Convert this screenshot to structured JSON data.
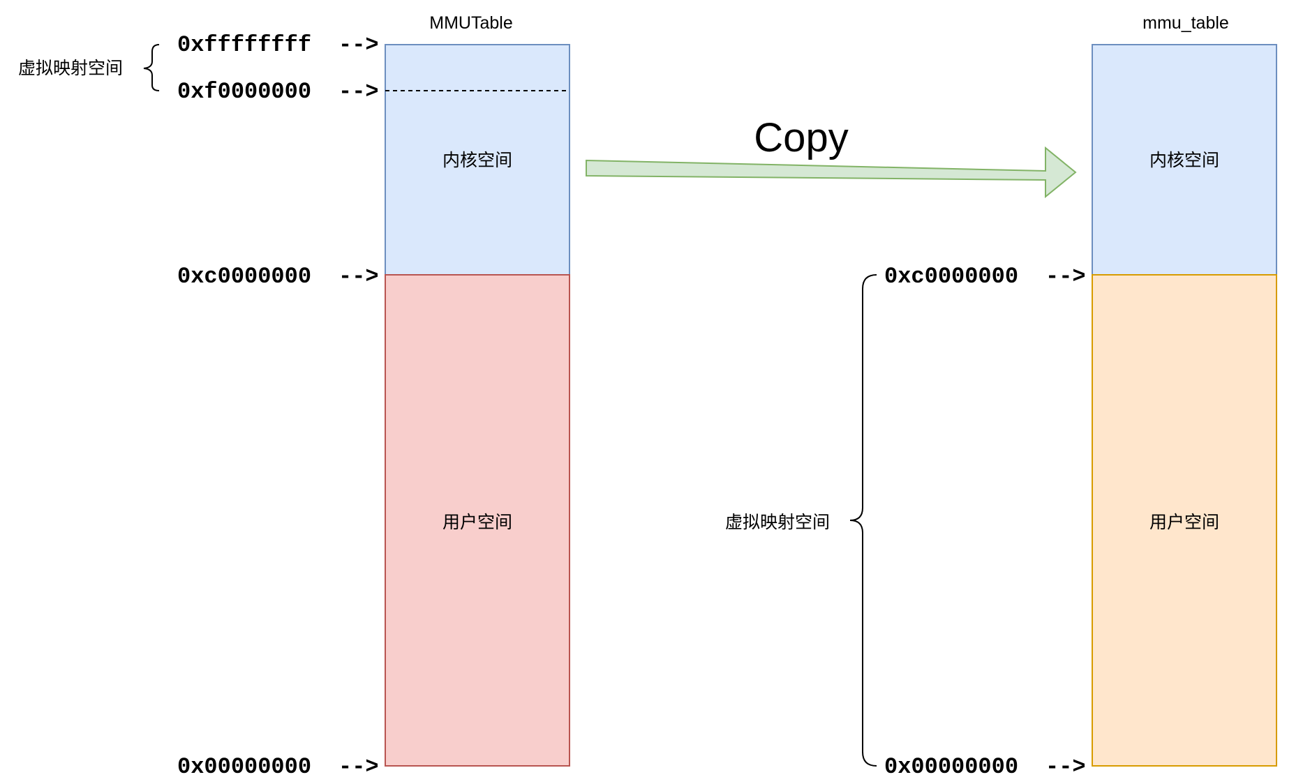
{
  "left_table": {
    "title": "MMUTable",
    "kernel_label": "内核空间",
    "user_label": "用户空间",
    "bracket_label": "虚拟映射空间",
    "addresses": {
      "top": "0xffffffff",
      "mapped_start": "0xf0000000",
      "kernel_start": "0xc0000000",
      "bottom": "0x00000000"
    },
    "colors": {
      "kernel_fill": "#dae8fc",
      "kernel_stroke": "#6c8ebf",
      "user_fill": "#f8cecc",
      "user_stroke": "#b85450"
    }
  },
  "right_table": {
    "title": "mmu_table",
    "kernel_label": "内核空间",
    "user_label": "用户空间",
    "bracket_label": "虚拟映射空间",
    "addresses": {
      "kernel_start": "0xc0000000",
      "bottom": "0x00000000"
    },
    "colors": {
      "kernel_fill": "#dae8fc",
      "kernel_stroke": "#6c8ebf",
      "user_fill": "#ffe6cc",
      "user_stroke": "#d79b00"
    }
  },
  "copy_arrow": {
    "label": "Copy",
    "fill": "#d5e8d4",
    "stroke": "#82b366"
  },
  "pointer_text": "-->"
}
